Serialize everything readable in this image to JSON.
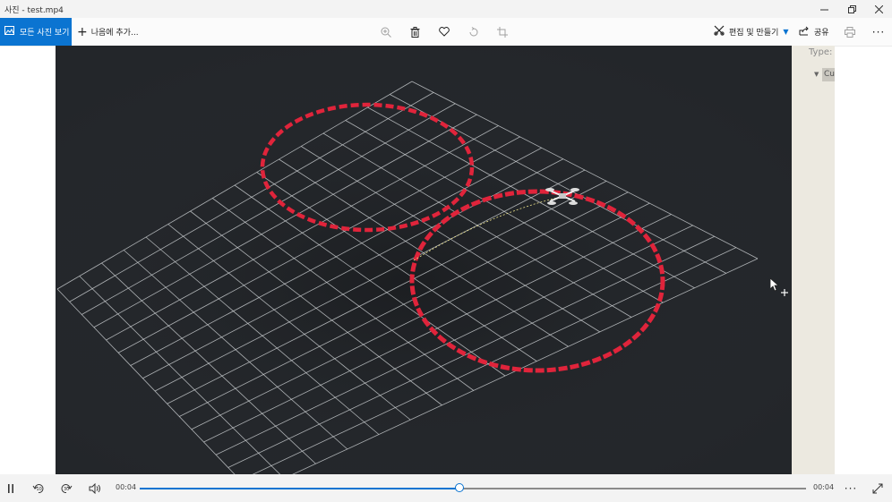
{
  "window": {
    "title": "사진 - test.mp4",
    "controls": [
      "minimize-icon",
      "restore-icon",
      "close-icon"
    ]
  },
  "toolbar": {
    "all_photos_label": "모든 사진 보기",
    "add_label": "나음에 추가...",
    "tools": [
      "zoom-in-icon",
      "delete-icon",
      "favorite-icon",
      "rotate-icon",
      "crop-icon"
    ],
    "edit_create_label": "편집 및 만들기",
    "share_label": "공유",
    "accent": "#0b74d1"
  },
  "video": {
    "side_panel": {
      "type_label": "Type:",
      "item_label": "Cu"
    }
  },
  "playback": {
    "current_time": "00:04",
    "total_time": "00:04",
    "progress": 0.48,
    "controls": [
      "pause-icon",
      "rewind-icon",
      "forward-icon",
      "volume-icon",
      "more-icon",
      "fullscreen-icon"
    ]
  }
}
